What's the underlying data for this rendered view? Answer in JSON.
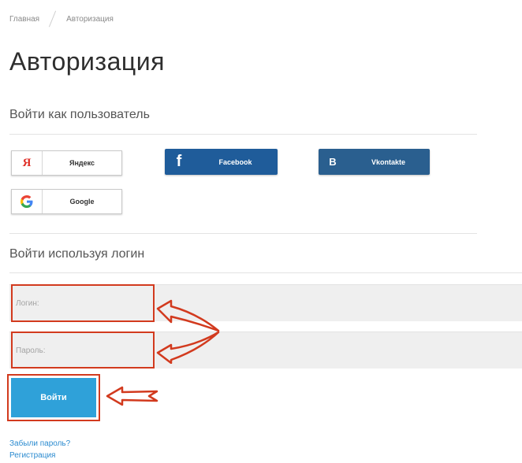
{
  "breadcrumb": {
    "home": "Главная",
    "current": "Авторизация"
  },
  "page_title": "Авторизация",
  "social_section": {
    "heading": "Войти как пользователь",
    "yandex": {
      "label": "Яндекс",
      "icon": "yandex-icon",
      "glyph": "Я",
      "color": "#e0322a"
    },
    "facebook": {
      "label": "Facebook",
      "icon": "facebook-icon",
      "glyph": "f",
      "color": "#1f5c9a"
    },
    "vkontakte": {
      "label": "Vkontakte",
      "icon": "vk-icon",
      "glyph": "B",
      "color": "#2a5f8f"
    },
    "google": {
      "label": "Google",
      "icon": "google-icon",
      "glyph": "G"
    }
  },
  "login_section": {
    "heading": "Войти используя логин",
    "login_placeholder": "Логин:",
    "password_placeholder": "Пароль:",
    "submit_label": "Войти",
    "submit_color": "#2fa1d9",
    "forgot_link": "Забыли пароль?",
    "register_link": "Регистрация"
  },
  "annotations": {
    "color": "#d23a1e"
  }
}
